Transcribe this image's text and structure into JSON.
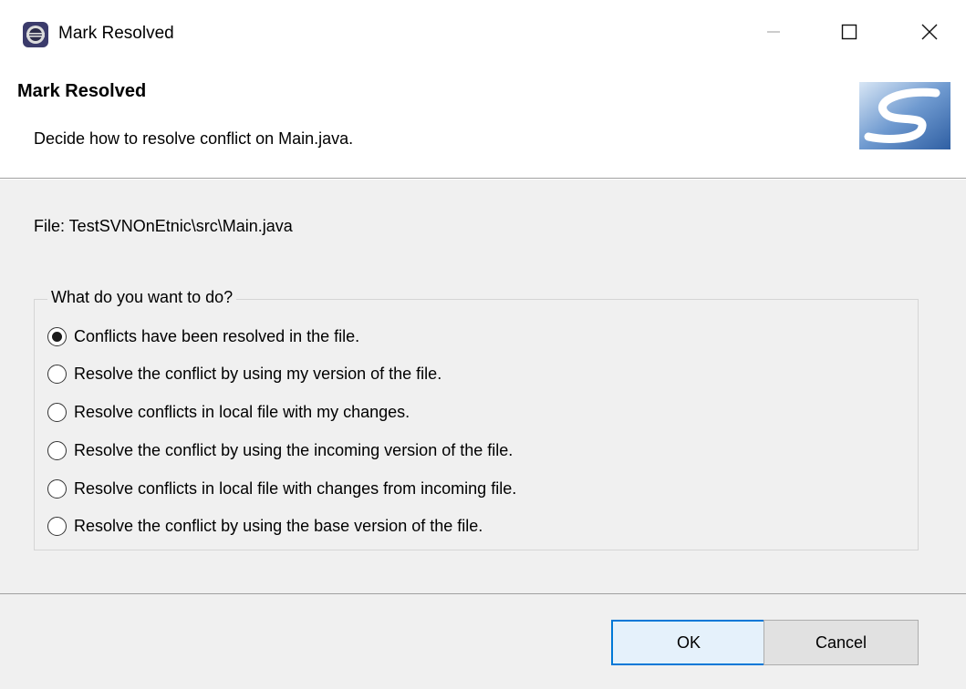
{
  "window": {
    "title": "Mark Resolved",
    "controls": [
      "minimize-icon",
      "maximize-icon",
      "close-icon"
    ]
  },
  "banner": {
    "title": "Mark Resolved",
    "description": "Decide how to resolve conflict on Main.java."
  },
  "file": {
    "label": "File: TestSVNOnEtnic\\src\\Main.java"
  },
  "group": {
    "legend": "What do you want to do?",
    "options": [
      {
        "label": "Conflicts have been resolved in the file.",
        "selected": true
      },
      {
        "label": "Resolve the conflict by using my version of the file.",
        "selected": false
      },
      {
        "label": "Resolve conflicts in local file with my changes.",
        "selected": false
      },
      {
        "label": "Resolve the conflict by using the incoming version of the file.",
        "selected": false
      },
      {
        "label": "Resolve conflicts in local file with changes from incoming file.",
        "selected": false
      },
      {
        "label": "Resolve the conflict by using the base version of the file.",
        "selected": false
      }
    ]
  },
  "buttons": {
    "ok": "OK",
    "cancel": "Cancel"
  },
  "colors": {
    "dialog_bg": "#f0f0f0",
    "default_button_border": "#0078d7"
  }
}
